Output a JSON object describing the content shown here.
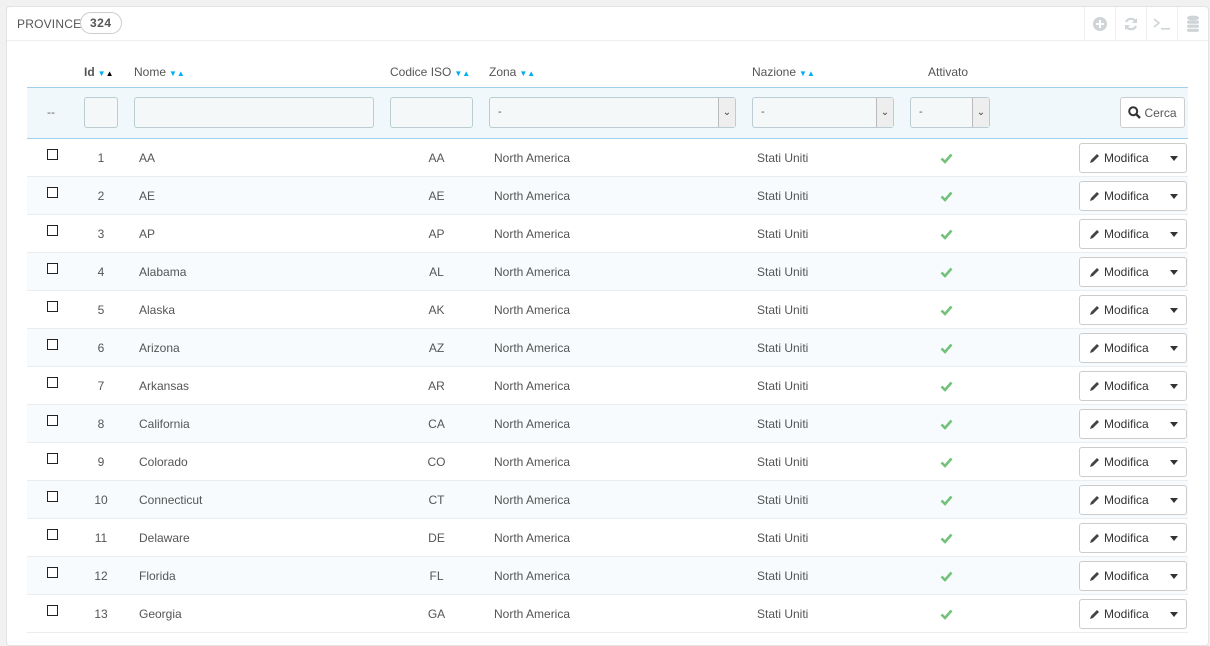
{
  "panel": {
    "title": "PROVINCE",
    "count": "324",
    "toolbar_icons": [
      "add-icon",
      "refresh-icon",
      "terminal-icon",
      "database-icon"
    ]
  },
  "columns": {
    "id": "Id",
    "name": "Nome",
    "iso": "Codice ISO",
    "zone": "Zona",
    "country": "Nazione",
    "active": "Attivato"
  },
  "filters": {
    "bulk": "--",
    "zone_value": "-",
    "country_value": "-",
    "active_value": "-",
    "search_label": "Cerca"
  },
  "row_action": "Modifica",
  "colors": {
    "accent": "#00aff0",
    "check": "#72c279",
    "filter_bg": "#f0f8fc"
  },
  "rows": [
    {
      "id": "1",
      "name": "AA",
      "iso": "AA",
      "zone": "North America",
      "country": "Stati Uniti"
    },
    {
      "id": "2",
      "name": "AE",
      "iso": "AE",
      "zone": "North America",
      "country": "Stati Uniti"
    },
    {
      "id": "3",
      "name": "AP",
      "iso": "AP",
      "zone": "North America",
      "country": "Stati Uniti"
    },
    {
      "id": "4",
      "name": "Alabama",
      "iso": "AL",
      "zone": "North America",
      "country": "Stati Uniti"
    },
    {
      "id": "5",
      "name": "Alaska",
      "iso": "AK",
      "zone": "North America",
      "country": "Stati Uniti"
    },
    {
      "id": "6",
      "name": "Arizona",
      "iso": "AZ",
      "zone": "North America",
      "country": "Stati Uniti"
    },
    {
      "id": "7",
      "name": "Arkansas",
      "iso": "AR",
      "zone": "North America",
      "country": "Stati Uniti"
    },
    {
      "id": "8",
      "name": "California",
      "iso": "CA",
      "zone": "North America",
      "country": "Stati Uniti"
    },
    {
      "id": "9",
      "name": "Colorado",
      "iso": "CO",
      "zone": "North America",
      "country": "Stati Uniti"
    },
    {
      "id": "10",
      "name": "Connecticut",
      "iso": "CT",
      "zone": "North America",
      "country": "Stati Uniti"
    },
    {
      "id": "11",
      "name": "Delaware",
      "iso": "DE",
      "zone": "North America",
      "country": "Stati Uniti"
    },
    {
      "id": "12",
      "name": "Florida",
      "iso": "FL",
      "zone": "North America",
      "country": "Stati Uniti"
    },
    {
      "id": "13",
      "name": "Georgia",
      "iso": "GA",
      "zone": "North America",
      "country": "Stati Uniti"
    }
  ]
}
